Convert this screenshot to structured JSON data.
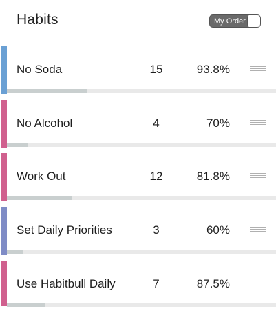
{
  "header": {
    "title": "Habits",
    "toggle_label": "My Order",
    "toggle_on": false
  },
  "habits": [
    {
      "name": "No Soda",
      "count": "15",
      "percent": "93.8%",
      "color": "#6aa0d4",
      "progress": 0.3
    },
    {
      "name": "No Alcohol",
      "count": "4",
      "percent": "70%",
      "color": "#d0608e",
      "progress": 0.08
    },
    {
      "name": "Work Out",
      "count": "12",
      "percent": "81.8%",
      "color": "#d0608e",
      "progress": 0.24
    },
    {
      "name": "Set Daily Priorities",
      "count": "3",
      "percent": "60%",
      "color": "#7f8cc6",
      "progress": 0.06
    },
    {
      "name": "Use Habitbull Daily",
      "count": "7",
      "percent": "87.5%",
      "color": "#d0608e",
      "progress": 0.14
    }
  ],
  "icons": {
    "reorder": "drag-handle-icon"
  }
}
